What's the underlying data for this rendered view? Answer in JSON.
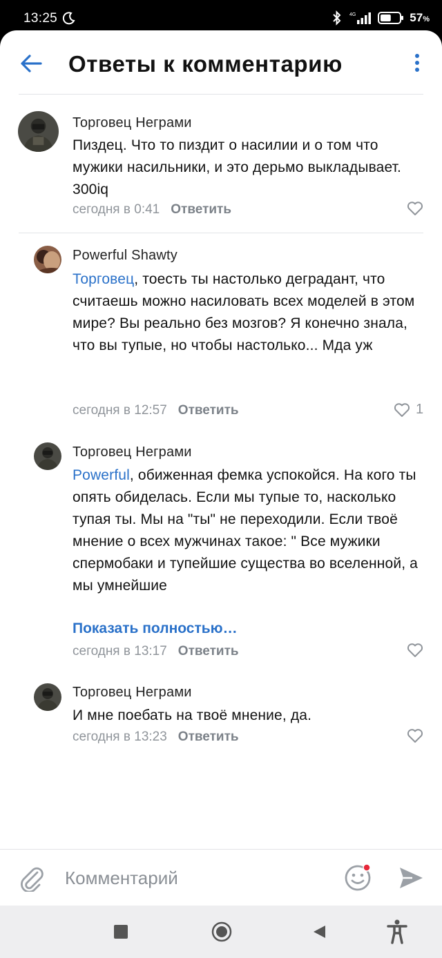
{
  "status_bar": {
    "time": "13:25",
    "network": "4G",
    "battery_percent": "57",
    "battery_unit": "%",
    "battery_level": 0.57
  },
  "header": {
    "title": "Ответы к комментарию"
  },
  "comments": [
    {
      "author": "Торговец Неграми",
      "mention": "",
      "text": "Пиздец. Что то пиздит о насилии и о том что мужики насильники, и  это дерьмо выкладывает. 300iq",
      "time": "сегодня в 0:41",
      "reply_label": "Ответить",
      "likes": ""
    },
    {
      "author": "Powerful Shawty",
      "mention": "Торговец",
      "text": ", тоесть ты настолько деградант, что считаешь можно насиловать всех моделей в этом мире? Вы реально без мозгов? Я конечно знала, что вы тупые, но чтобы настолько... Мда уж",
      "time": "сегодня в 12:57",
      "reply_label": "Ответить",
      "likes": "1"
    },
    {
      "author": "Торговец Неграми",
      "mention": "Powerful",
      "text": ", обиженная фемка успокойся. На кого ты опять обиделась. Если мы тупые то, насколько тупая ты. Мы на \"ты\" не переходили. Если твоё мнение о всех мужчинах такое: \" Все мужики спермобаки и тупейшие существа во вселенной, а мы умнейшие",
      "show_full": "Показать полностью…",
      "time": "сегодня в 13:17",
      "reply_label": "Ответить",
      "likes": ""
    },
    {
      "author": "Торговец Неграми",
      "mention": "",
      "text": "И мне поебать на твоё мнение, да.",
      "time": "сегодня в 13:23",
      "reply_label": "Ответить",
      "likes": ""
    }
  ],
  "composer": {
    "placeholder": "Комментарий"
  },
  "colors": {
    "accent": "#2a71c9",
    "muted": "#8f949a",
    "divider": "#e2e3e6",
    "notification_dot": "#e6283a"
  },
  "icons": [
    "moon-icon",
    "bluetooth-icon",
    "signal-icon",
    "battery-icon",
    "back-arrow-icon",
    "more-vertical-icon",
    "heart-icon",
    "paperclip-icon",
    "emoji-icon",
    "send-icon",
    "stop-square-icon",
    "home-circle-icon",
    "back-triangle-icon",
    "accessibility-icon"
  ]
}
